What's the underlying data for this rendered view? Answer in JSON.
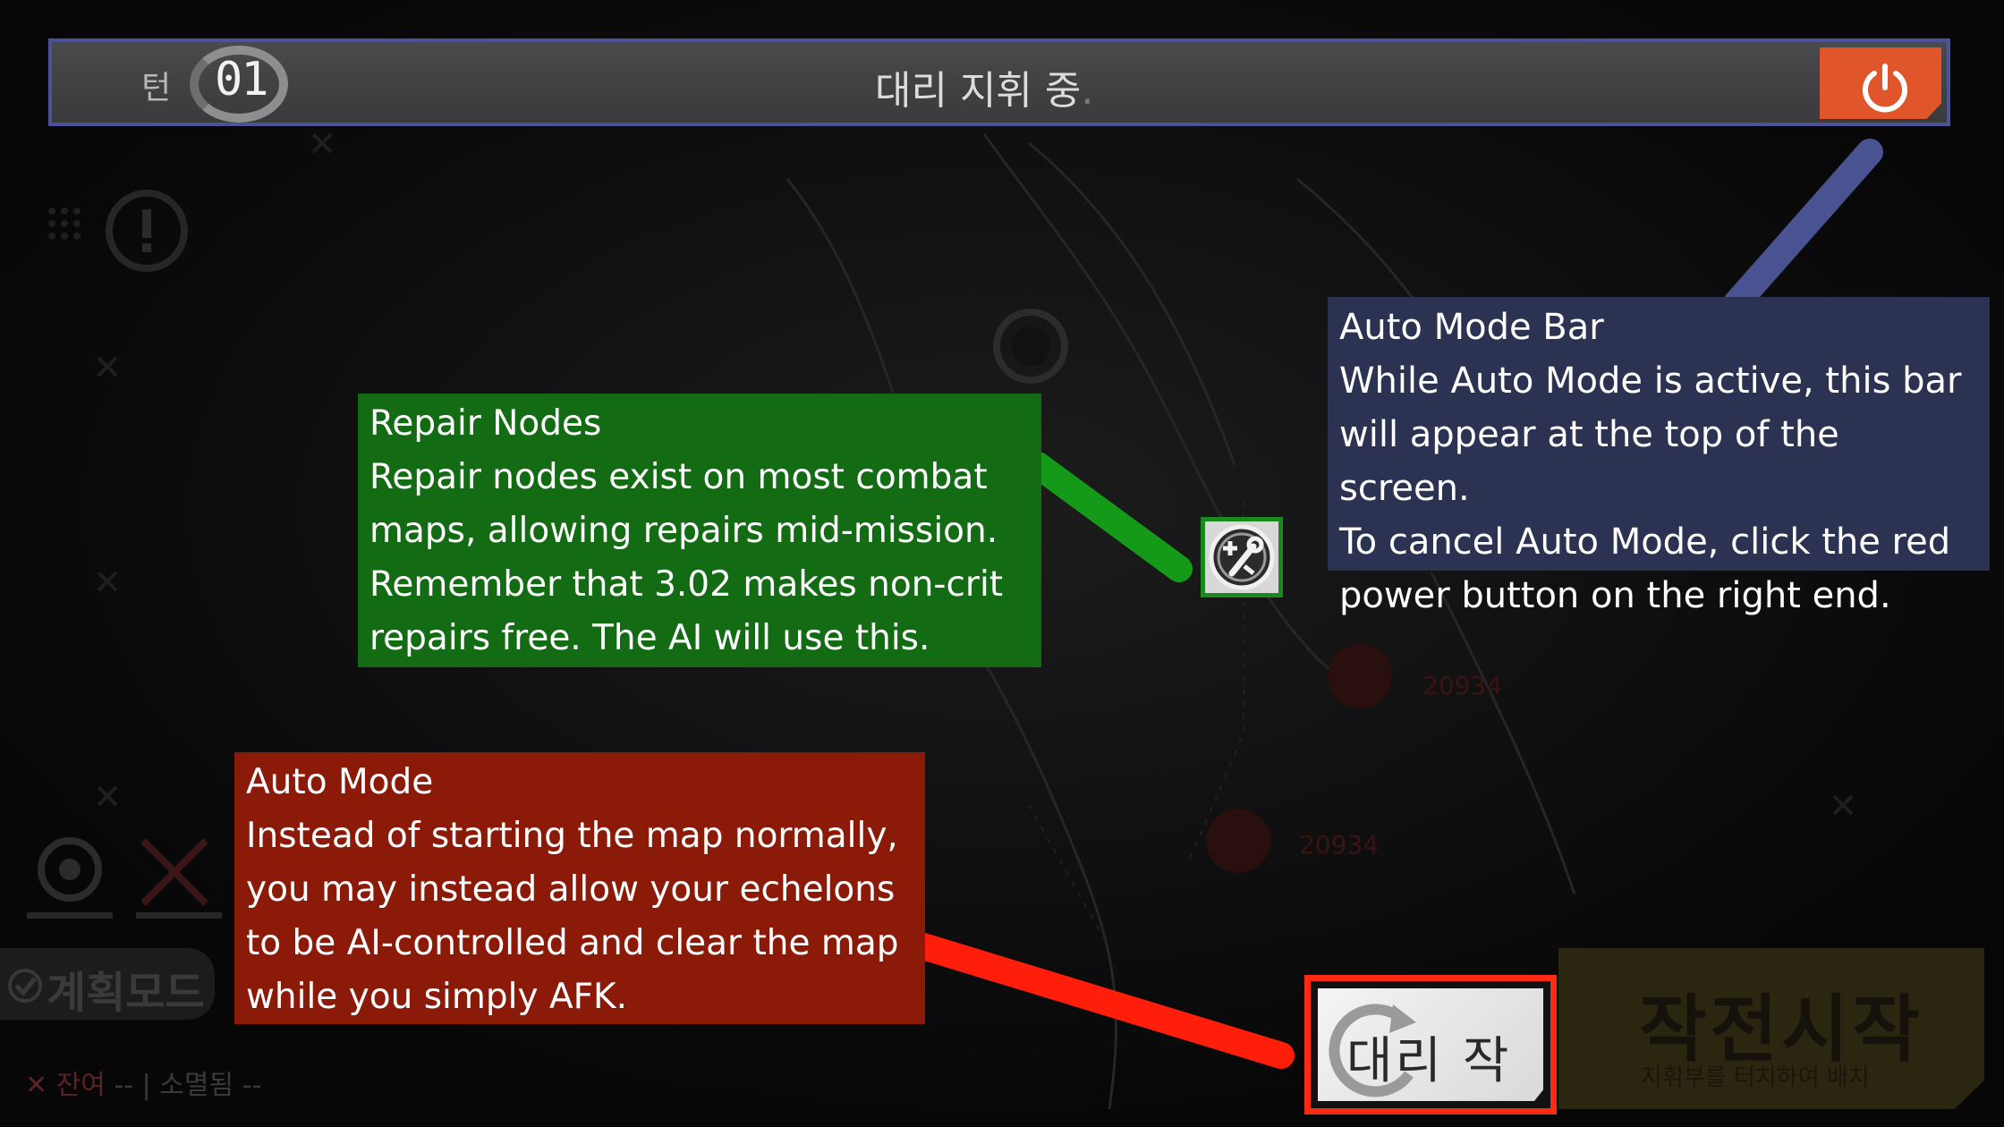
{
  "top_bar": {
    "turn_label": "턴",
    "turn_number": "01",
    "status_text": "대리 지휘 중",
    "status_suffix": ".",
    "power_button_icon": "power-icon",
    "border_color": "#4c5296",
    "power_color": "#e0552a"
  },
  "left_hud": {
    "alert_icon": "exclamation-icon",
    "plan_mode_label": "계획모드",
    "status_active_label": "잔여",
    "status_active_value": "--",
    "status_destroyed_label": "소멸됨",
    "status_destroyed_value": "--"
  },
  "map_labels": {
    "enemy_code_1": "20934",
    "enemy_code_2": "20934"
  },
  "start_operation": {
    "label": "작전시작",
    "sub_label": "지휘부를 터치하여 배치"
  },
  "auto_battle_button": {
    "label": "대리 작전",
    "icon": "refresh-cycle-icon",
    "highlight_color": "#ff2a12"
  },
  "repair_node": {
    "icon": "repair-wrench-icon",
    "border_color": "#1a8a1f"
  },
  "annotations": {
    "repair_nodes": {
      "title": "Repair Nodes",
      "body": "Repair nodes exist on most combat\nmaps, allowing repairs mid-mission.\nRemember that 3.02 makes non-crit\nrepairs free. The AI will use this.",
      "color": "#136b14"
    },
    "auto_mode": {
      "title": "Auto Mode",
      "body": "Instead of starting the map normally,\nyou may instead allow your echelons\nto be AI-controlled and clear the map\nwhile you simply AFK.",
      "color": "#8b1a09"
    },
    "auto_mode_bar": {
      "title": "Auto Mode Bar",
      "body": "While Auto Mode is active, this bar\nwill appear at the top of the screen.\nTo cancel Auto Mode, click the red\npower button on the right end.",
      "color": "#2c3352"
    }
  }
}
